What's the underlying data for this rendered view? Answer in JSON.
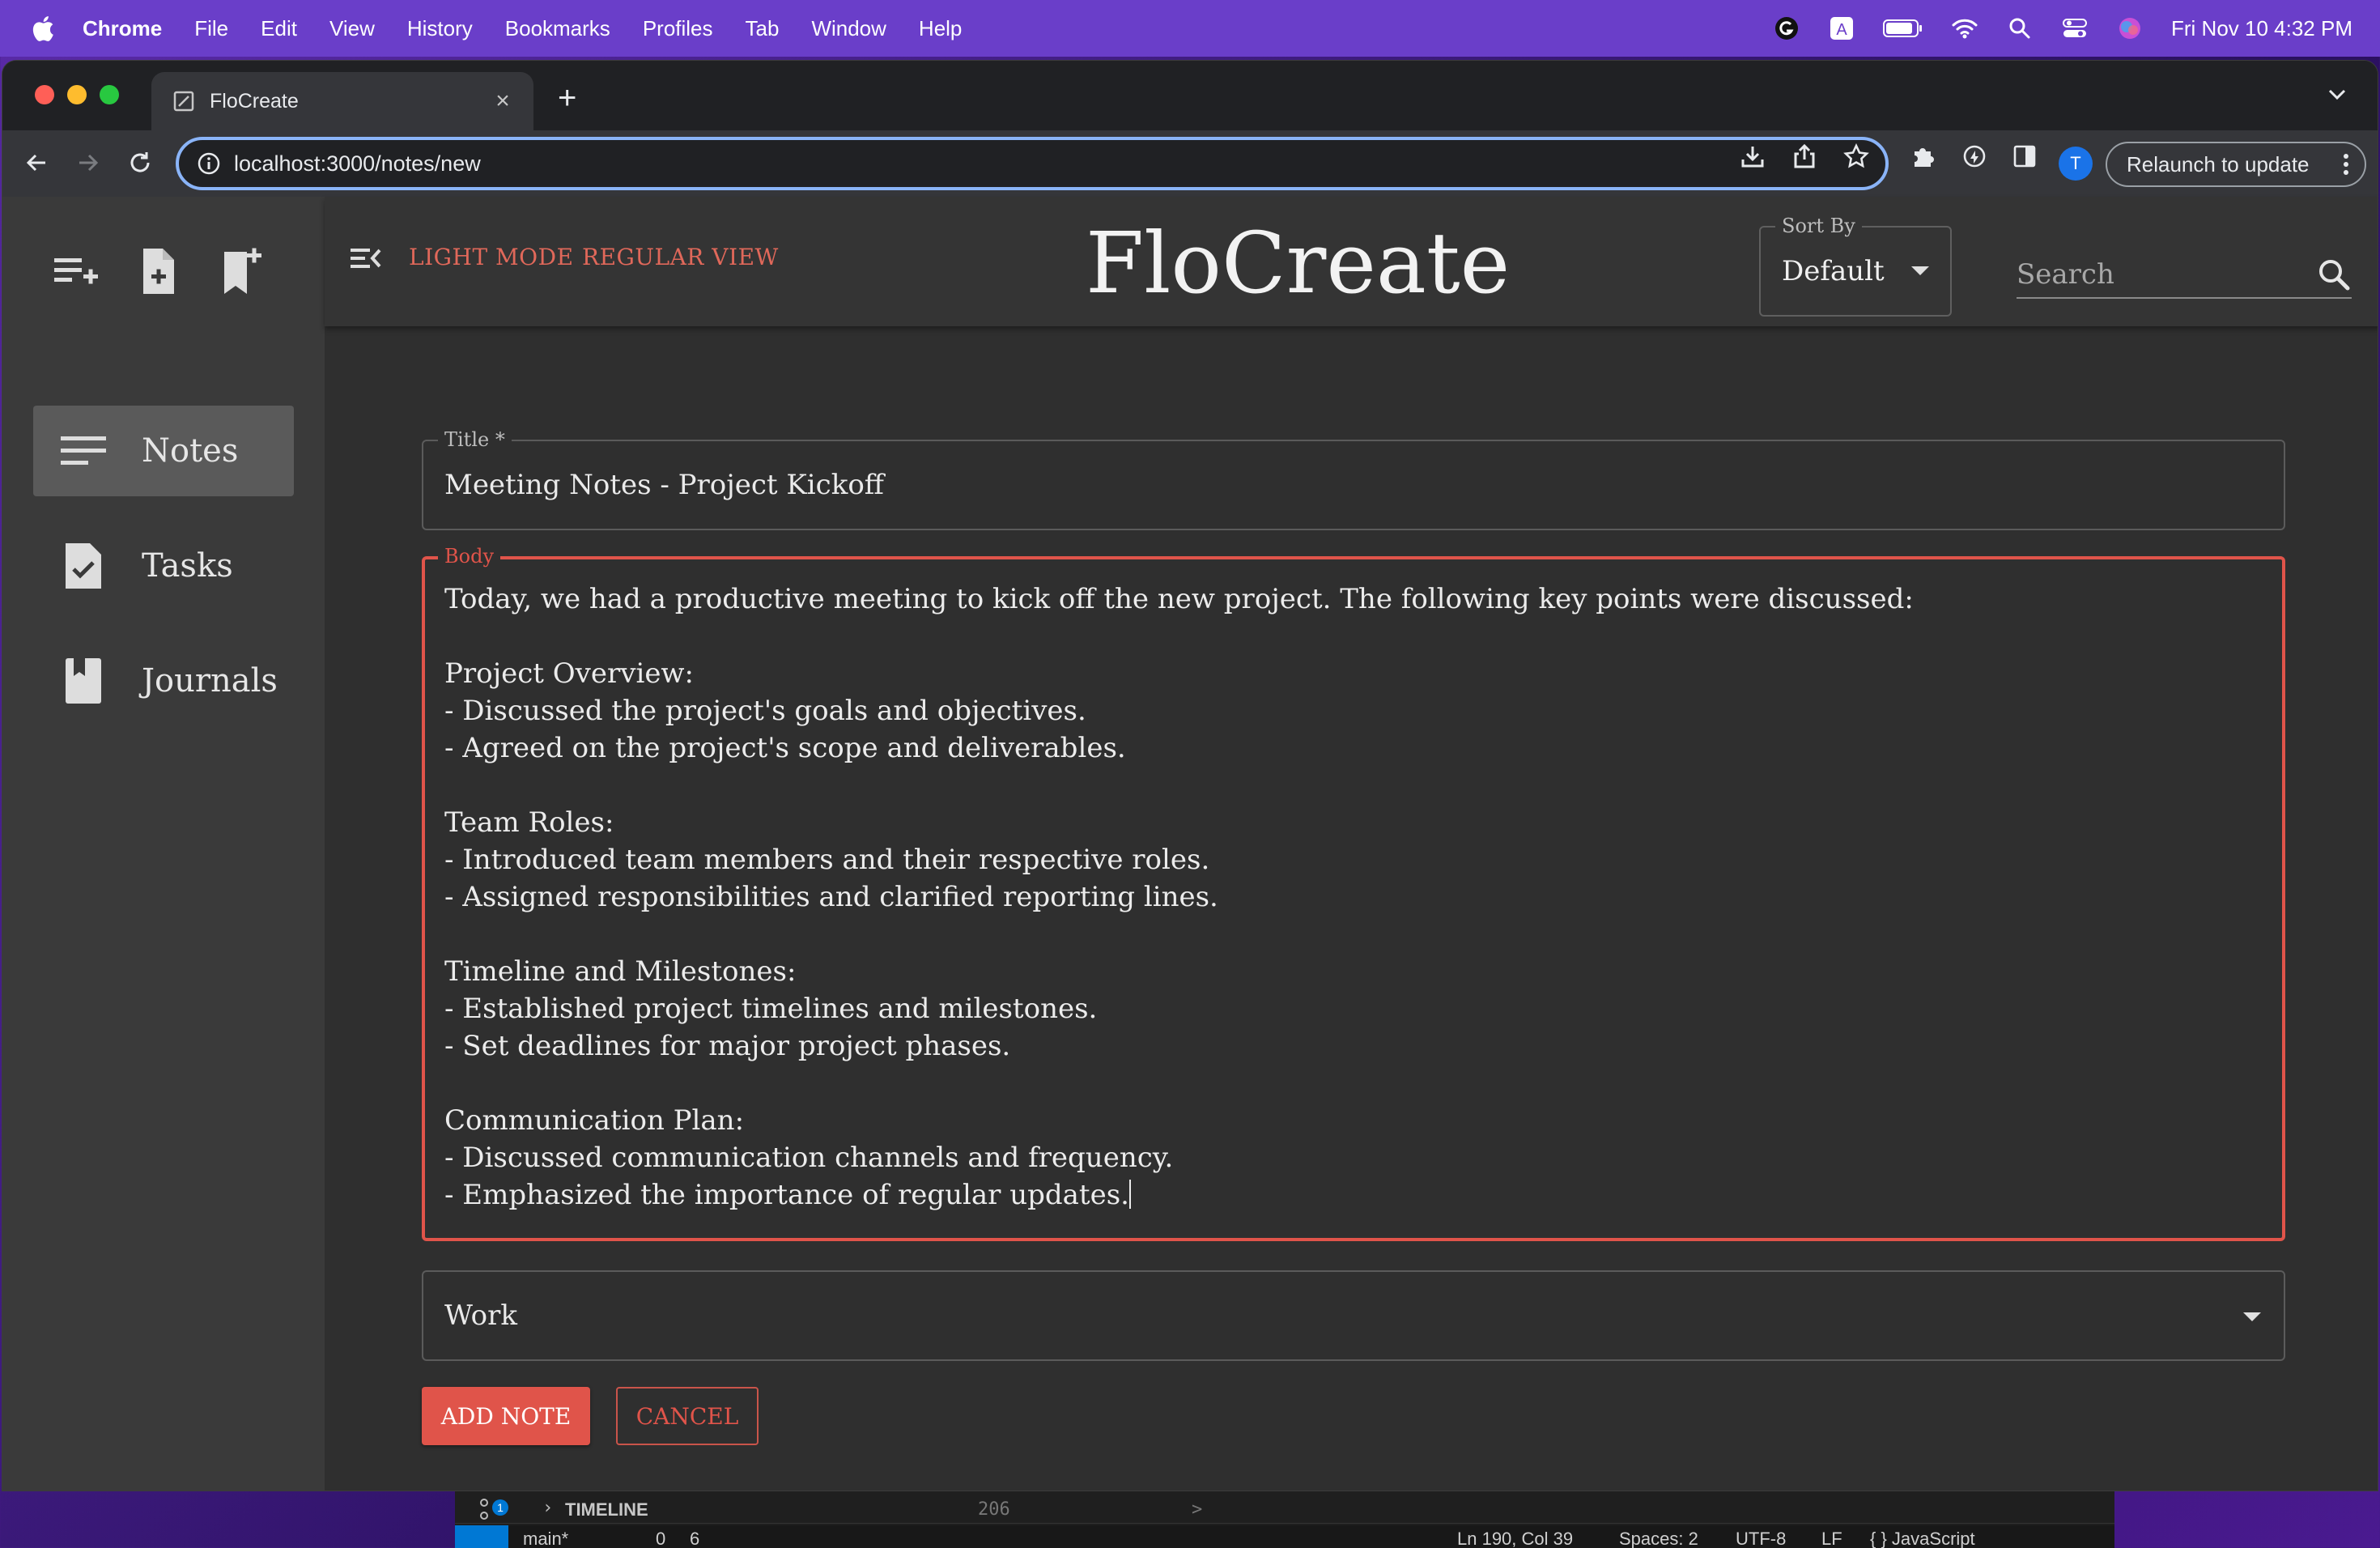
{
  "menubar": {
    "app_name": "Chrome",
    "items": [
      "File",
      "Edit",
      "View",
      "History",
      "Bookmarks",
      "Profiles",
      "Tab",
      "Window",
      "Help"
    ],
    "datetime": "Fri Nov 10  4:32 PM",
    "tray_letter": "A"
  },
  "browser": {
    "tab_title": "FloCreate",
    "new_tab_symbol": "+",
    "url": "localhost:3000/notes/new",
    "relaunch_label": "Relaunch to update",
    "profile_initial": "T",
    "accent_color": "#8ab4f8"
  },
  "app": {
    "brand": "FloCreate",
    "top_links": {
      "light_mode": "LIGHT MODE",
      "regular_view": "REGULAR VIEW"
    },
    "sort": {
      "label": "Sort By",
      "value": "Default"
    },
    "search": {
      "placeholder": "Search"
    },
    "sidebar": {
      "items": [
        {
          "label": "Notes",
          "icon": "notes-icon",
          "active": true
        },
        {
          "label": "Tasks",
          "icon": "task-icon",
          "active": false
        },
        {
          "label": "Journals",
          "icon": "journal-icon",
          "active": false
        }
      ]
    },
    "form": {
      "title_label": "Title *",
      "title_value": "Meeting Notes - Project Kickoff",
      "body_label": "Body",
      "body_value": "Today, we had a productive meeting to kick off the new project. The following key points were discussed:\n\nProject Overview:\n- Discussed the project's goals and objectives.\n- Agreed on the project's scope and deliverables.\n\nTeam Roles:\n- Introduced team members and their respective roles.\n- Assigned responsibilities and clarified reporting lines.\n\nTimeline and Milestones:\n- Established project timelines and milestones.\n- Set deadlines for major project phases.\n\nCommunication Plan:\n- Discussed communication channels and frequency.\n- Emphasized the importance of regular updates.",
      "category_value": "Work",
      "add_label": "ADD NOTE",
      "cancel_label": "CANCEL"
    },
    "accent_color": "#e0544a"
  },
  "background_editor": {
    "timeline_label": "TIMELINE",
    "badge": "1",
    "line_number": "206",
    "chevron": ">",
    "branch": "main*",
    "problems": "0",
    "warnings": "6",
    "cursor_pos": "Ln 190, Col 39",
    "spaces": "Spaces: 2",
    "encoding": "UTF-8",
    "eol": "LF",
    "language": "{ } JavaScript"
  }
}
